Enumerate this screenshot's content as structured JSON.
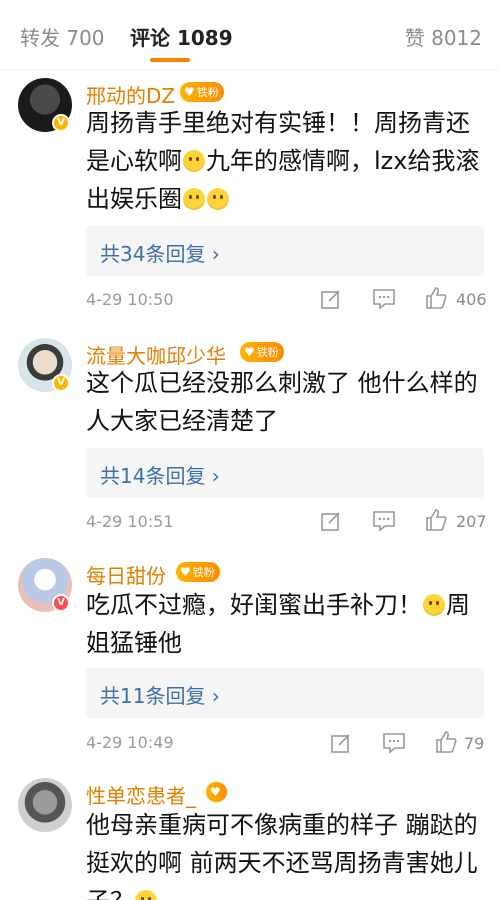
{
  "tabs": {
    "repost": "转发 700",
    "comments": "评论 1089",
    "likes": "赞 8012"
  },
  "comments": [
    {
      "username": "邢动的DZ",
      "badge": "铁粉",
      "text_parts": [
        "周扬青手里绝对有实锤！！周扬青还是心软啊",
        "九年的感情啊，lzx给我滚出娱乐圈"
      ],
      "replies": "共34条回复 ›",
      "time": "4-29 10:50",
      "likes": "406"
    },
    {
      "username": "流量大咖邱少华",
      "badge": "铁粉",
      "text_parts": [
        "这个瓜已经没那么刺激了 他什么样的人大家已经清楚了"
      ],
      "replies": "共14条回复 ›",
      "time": "4-29 10:51",
      "likes": "207"
    },
    {
      "username": "每日甜份",
      "badge": "铁粉",
      "text_parts": [
        "吃瓜不过瘾，好闺蜜出手补刀！",
        "周姐猛锤他"
      ],
      "replies": "共11条回复 ›",
      "time": "4-29 10:49",
      "likes": "79"
    },
    {
      "username": "性单恋患者_",
      "badge": "",
      "text_parts": [
        "他母亲重病可不像病重的样子 蹦跶的挺欢的啊 前两天不还骂周扬青害她儿子？"
      ],
      "replies": "",
      "time": "",
      "likes": ""
    }
  ],
  "colors": {
    "accent": "#ff8200",
    "username": "#e67e00",
    "reply_link": "#3d6fa8",
    "meta": "#9a9a9a"
  },
  "icons": [
    "edit-icon",
    "comment-icon",
    "thumbs-up-icon",
    "v-verified-icon",
    "heart-badge-icon"
  ]
}
